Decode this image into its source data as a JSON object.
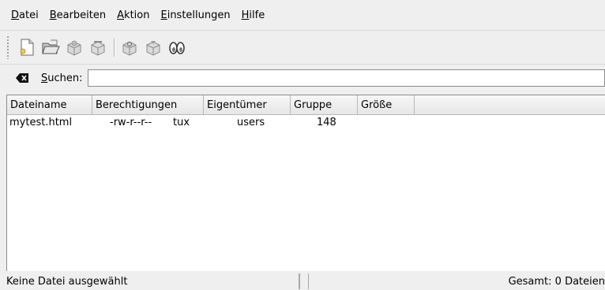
{
  "menubar": {
    "items": [
      {
        "mnemonic": "D",
        "rest": "atei"
      },
      {
        "mnemonic": "B",
        "rest": "earbeiten"
      },
      {
        "mnemonic": "A",
        "rest": "ktion"
      },
      {
        "mnemonic": "E",
        "rest": "instellungen"
      },
      {
        "mnemonic": "H",
        "rest": "ilfe"
      }
    ]
  },
  "toolbar": {
    "icons": [
      "new-file-icon",
      "open-folder-icon",
      "package-add-icon",
      "package-remove-icon",
      "package-settings-icon",
      "package-config-icon",
      "search-binoculars-icon"
    ]
  },
  "search": {
    "label_mnemonic": "S",
    "label_rest": "uchen:",
    "value": ""
  },
  "filelist": {
    "columns": [
      "Dateiname",
      "Berechtigungen",
      "Eigentümer",
      "Gruppe",
      "Größe"
    ],
    "rows": [
      {
        "name": "mytest.html",
        "permissions": "-rw-r--r--",
        "owner": "tux",
        "group": "users",
        "size": "148"
      }
    ]
  },
  "status": {
    "left": "Keine Datei ausgewählt",
    "right": "Gesamt: 0 Dateien"
  }
}
